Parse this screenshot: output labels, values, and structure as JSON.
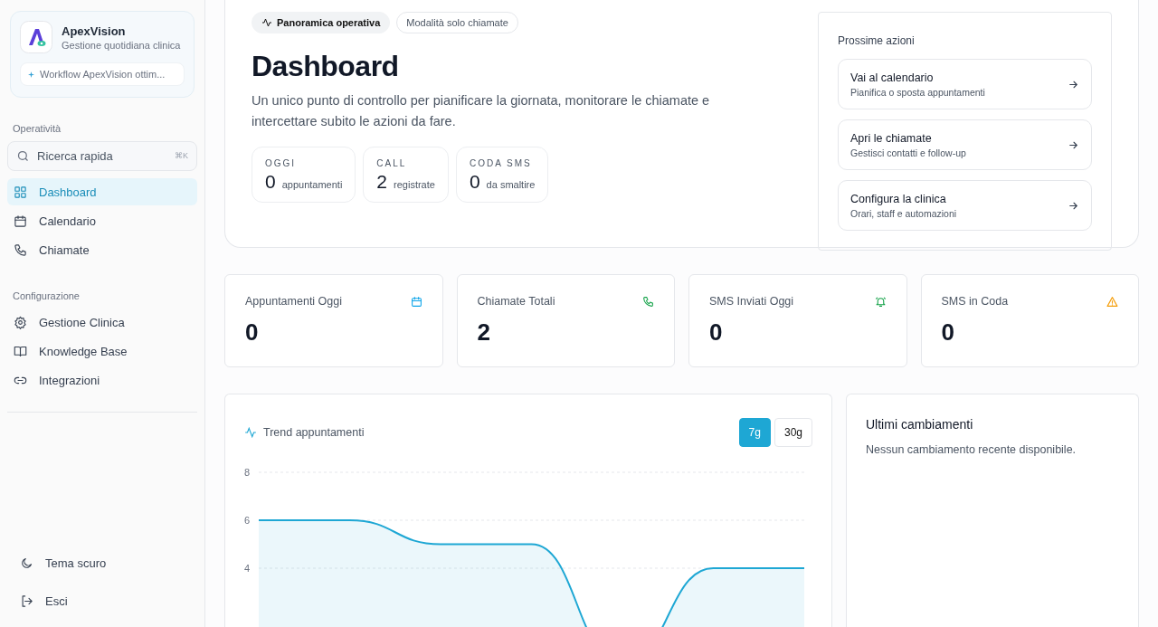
{
  "sidebar": {
    "brand": {
      "name": "ApexVision",
      "subtitle": "Gestione quotidiana clinica",
      "workflow": "Workflow ApexVision ottim..."
    },
    "sections": [
      {
        "title": "Operatività",
        "search": {
          "placeholder": "Ricerca rapida",
          "shortcut": "⌘K"
        },
        "items": [
          {
            "label": "Dashboard",
            "selected": true
          },
          {
            "label": "Calendario",
            "selected": false
          },
          {
            "label": "Chiamate",
            "selected": false
          }
        ]
      },
      {
        "title": "Configurazione",
        "items": [
          {
            "label": "Gestione Clinica",
            "selected": false
          },
          {
            "label": "Knowledge Base",
            "selected": false
          },
          {
            "label": "Integrazioni",
            "selected": false
          }
        ]
      }
    ],
    "footer": [
      {
        "label": "Tema scuro"
      },
      {
        "label": "Esci"
      }
    ]
  },
  "header": {
    "tabs": [
      {
        "label": "Panoramica operativa",
        "selected": true
      },
      {
        "label": "Modalità solo chiamate",
        "selected": false
      }
    ],
    "title": "Dashboard",
    "description": "Un unico punto di controllo per pianificare la giornata, monitorare le chiamate e intercettare subito le azioni da fare.",
    "mini_stats": [
      {
        "label": "OGGI",
        "value": "0",
        "caption": "appuntamenti"
      },
      {
        "label": "CALL",
        "value": "2",
        "caption": "registrate"
      },
      {
        "label": "CODA SMS",
        "value": "0",
        "caption": "da smaltire"
      }
    ],
    "next_actions": {
      "title": "Prossime azioni",
      "items": [
        {
          "title": "Vai al calendario",
          "subtitle": "Pianifica o sposta appuntamenti"
        },
        {
          "title": "Apri le chiamate",
          "subtitle": "Gestisci contatti e follow-up"
        },
        {
          "title": "Configura la clinica",
          "subtitle": "Orari, staff e automazioni"
        }
      ]
    }
  },
  "stats": [
    {
      "label": "Appuntamenti Oggi",
      "value": "0"
    },
    {
      "label": "Chiamate Totali",
      "value": "2"
    },
    {
      "label": "SMS Inviati Oggi",
      "value": "0"
    },
    {
      "label": "SMS in Coda",
      "value": "0"
    }
  ],
  "trend": {
    "title": "Trend appuntamenti",
    "ranges": [
      {
        "label": "7g",
        "selected": true
      },
      {
        "label": "30g",
        "selected": false
      }
    ],
    "chart_data": {
      "type": "area",
      "ylim": [
        0,
        8
      ],
      "yticks": [
        4,
        6,
        8
      ],
      "series": [
        {
          "color": "#1ea7d4",
          "values": [
            6,
            6,
            5,
            5,
            0,
            4,
            4
          ]
        }
      ]
    }
  },
  "changes": {
    "title": "Ultimi cambiamenti",
    "empty": "Nessun cambiamento recente disponibile."
  }
}
